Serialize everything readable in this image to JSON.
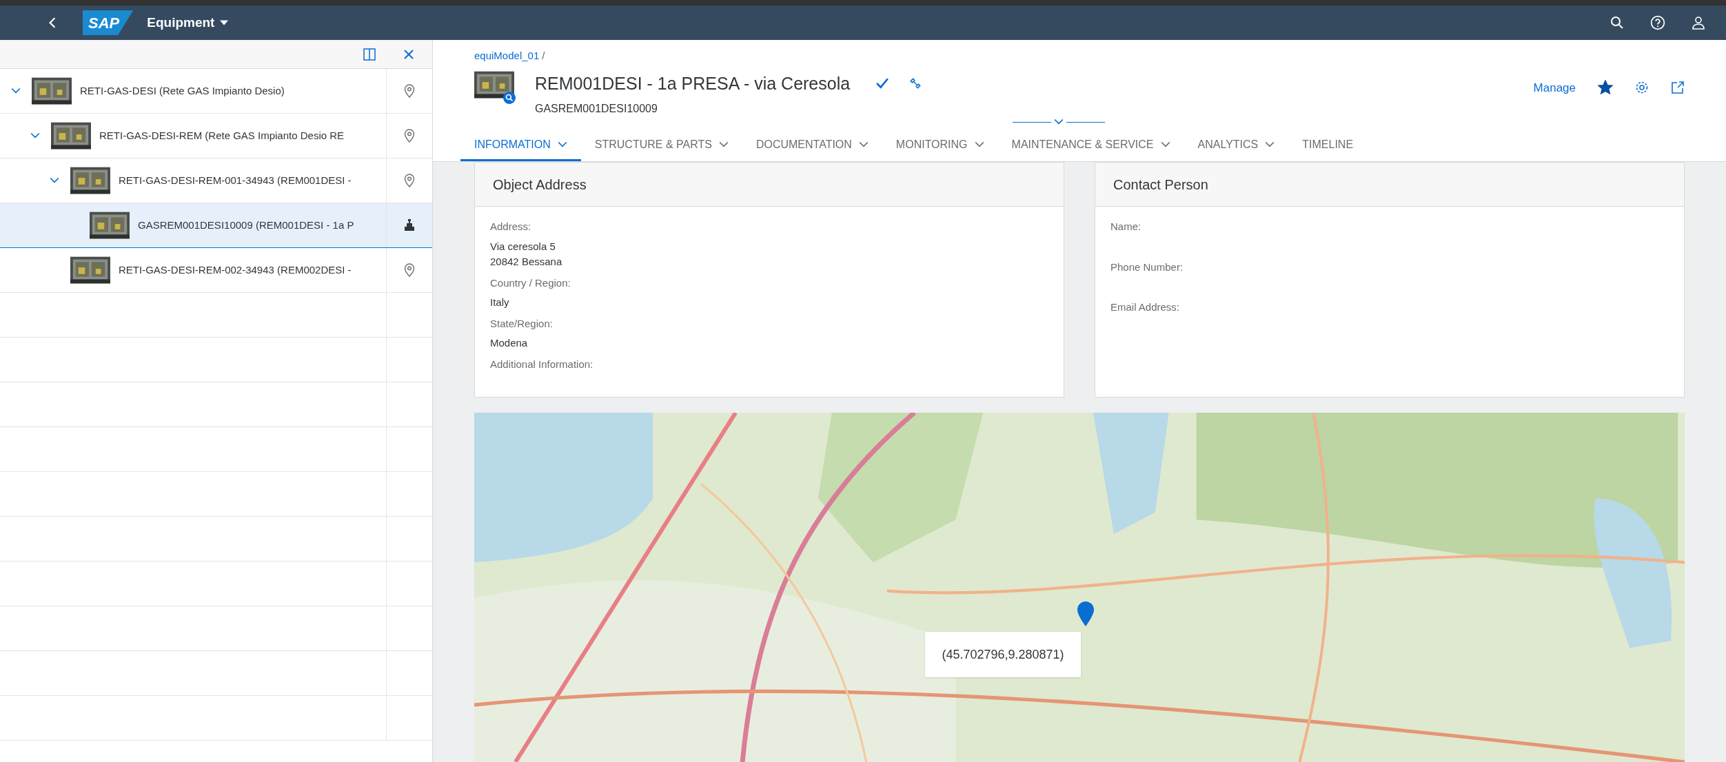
{
  "shell": {
    "title": "Equipment",
    "logo": "SAP"
  },
  "tree": [
    {
      "label": "RETI-GAS-DESI (Rete GAS Impianto Desio)",
      "kind": "location",
      "expanded": true,
      "selected": false,
      "children": [
        {
          "label": "RETI-GAS-DESI-REM (Rete GAS Impianto Desio RE",
          "kind": "location",
          "expanded": true,
          "selected": false,
          "children": [
            {
              "label": "RETI-GAS-DESI-REM-001-34943 (REM001DESI -",
              "kind": "location",
              "expanded": true,
              "selected": false,
              "children": [
                {
                  "label": "GASREM001DESI10009 (REM001DESI - 1a P",
                  "kind": "equipment",
                  "selected": true
                }
              ]
            },
            {
              "label": "RETI-GAS-DESI-REM-002-34943 (REM002DESI -",
              "kind": "location",
              "selected": false
            }
          ]
        }
      ]
    }
  ],
  "header": {
    "breadcrumb": "equiModel_01",
    "breadcrumb_separator": "/",
    "title": "REM001DESI - 1a PRESA - via Ceresola",
    "subtitle": "GASREM001DESI10009",
    "manage": "Manage",
    "favorite": true
  },
  "tabs": [
    {
      "label": "INFORMATION",
      "selected": true,
      "expandable": true
    },
    {
      "label": "STRUCTURE & PARTS",
      "selected": false,
      "expandable": true
    },
    {
      "label": "DOCUMENTATION",
      "selected": false,
      "expandable": true
    },
    {
      "label": "MONITORING",
      "selected": false,
      "expandable": true
    },
    {
      "label": "MAINTENANCE & SERVICE",
      "selected": false,
      "expandable": true
    },
    {
      "label": "ANALYTICS",
      "selected": false,
      "expandable": true
    },
    {
      "label": "TIMELINE",
      "selected": false,
      "expandable": false
    }
  ],
  "cards": [
    {
      "title": "Object Address",
      "fields": [
        {
          "label": "Address:",
          "value": [
            "Via ceresola 5",
            "20842 Bessana"
          ]
        },
        {
          "label": "Country / Region:",
          "value": [
            "Italy"
          ]
        },
        {
          "label": "State/Region:",
          "value": [
            "Modena"
          ]
        },
        {
          "label": "Additional Information:"
        }
      ]
    },
    {
      "title": "Contact Person",
      "fields": [
        {
          "label": "Name:"
        },
        {
          "label": "Phone Number:"
        },
        {
          "label": "Email Address:"
        }
      ]
    }
  ],
  "map": {
    "tooltip": "(45.702796,9.280871)"
  }
}
